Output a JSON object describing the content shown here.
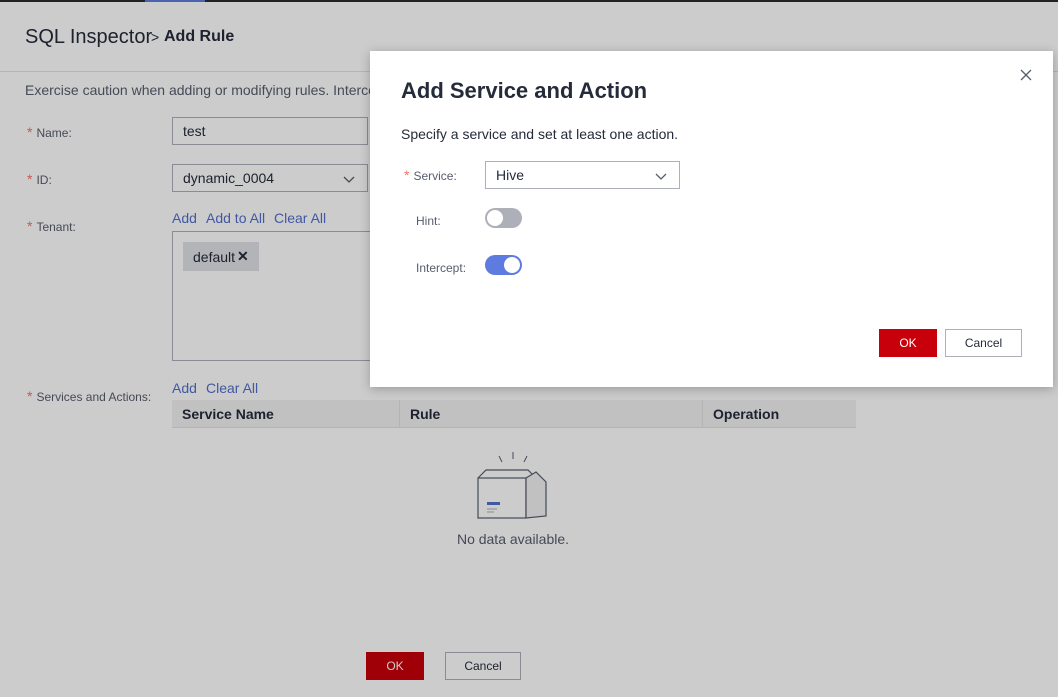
{
  "breadcrumb": {
    "root": "SQL Inspector",
    "separator": ">",
    "current": "Add Rule"
  },
  "caution_text": "Exercise caution when adding or modifying rules. Intercep",
  "form": {
    "name": {
      "label": "Name:",
      "value": "test"
    },
    "id": {
      "label": "ID:",
      "value": "dynamic_0004"
    },
    "tenant": {
      "label": "Tenant:",
      "links": {
        "add": "Add",
        "add_all": "Add to All",
        "clear_all": "Clear All"
      },
      "tags": [
        "default"
      ],
      "tag_remove_glyph": "✕"
    },
    "services": {
      "label": "Services and Actions:",
      "links": {
        "add": "Add",
        "clear_all": "Clear All"
      },
      "columns": [
        "Service Name",
        "Rule",
        "Operation"
      ],
      "empty_text": "No data available."
    },
    "required_mark": "*"
  },
  "footer": {
    "ok": "OK",
    "cancel": "Cancel"
  },
  "modal": {
    "title": "Add Service and Action",
    "description": "Specify a service and set at least one action.",
    "service": {
      "label": "Service:",
      "value": "Hive"
    },
    "hint": {
      "label": "Hint:",
      "enabled": false
    },
    "intercept": {
      "label": "Intercept:",
      "enabled": true
    },
    "ok": "OK",
    "cancel": "Cancel"
  },
  "colors": {
    "primary_button": "#c7000b",
    "link": "#526ecc",
    "toggle_on": "#5e7ce0",
    "toggle_off": "#adb0b8",
    "required": "#f66f6a"
  },
  "icons": [
    "chevron-down-icon",
    "close-icon",
    "empty-box-icon",
    "tag-remove-icon"
  ]
}
